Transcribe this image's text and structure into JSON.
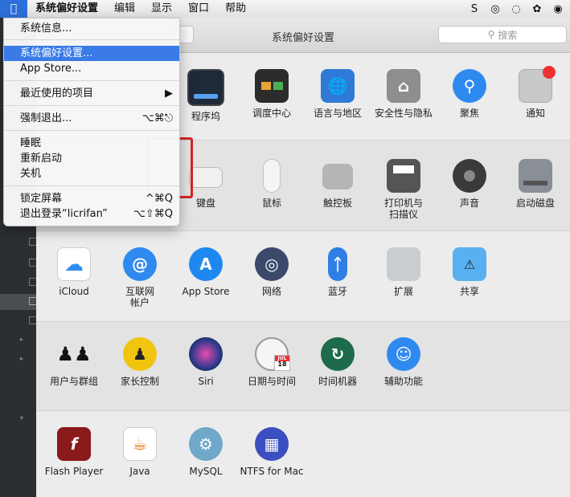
{
  "menubar": {
    "apple": "",
    "items": [
      "系统偏好设置",
      "编辑",
      "显示",
      "窗口",
      "帮助"
    ],
    "tray": [
      "S",
      "◎",
      "◌",
      "✿",
      "◉"
    ]
  },
  "window": {
    "title": "系统偏好设置",
    "search_placeholder": "搜索"
  },
  "apple_menu": {
    "items": [
      {
        "label": "系统信息...",
        "shortcut": ""
      },
      {
        "label": "系统偏好设置...",
        "shortcut": ""
      },
      {
        "label": "App Store...",
        "shortcut": ""
      },
      {
        "label": "最近使用的项目",
        "shortcut": "▶"
      },
      {
        "label": "强制退出...",
        "shortcut": "⌥⌘⎋"
      },
      {
        "label": "睡眠",
        "shortcut": ""
      },
      {
        "label": "重新启动",
        "shortcut": ""
      },
      {
        "label": "关机",
        "shortcut": ""
      },
      {
        "label": "锁定屏幕",
        "shortcut": "^⌘Q"
      },
      {
        "label": "退出登录“licrifan”",
        "shortcut": "⌥⇧⌘Q"
      }
    ]
  },
  "panes": {
    "dock": "程序坞",
    "mission_control": "调度中心",
    "language_region": "语言与地区",
    "security_privacy": "安全性与隐私",
    "spotlight": "聚焦",
    "notifications": "通知",
    "keyboard": "键盘",
    "mouse": "鼠标",
    "trackpad": "触控板",
    "printers": "打印机与\n扫描仪",
    "sound": "声音",
    "startup_disk": "启动磁盘",
    "icloud": "iCloud",
    "internet_accounts": "互联网\n帐户",
    "app_store": "App Store",
    "network": "网络",
    "bluetooth": "蓝牙",
    "extensions": "扩展",
    "sharing": "共享",
    "users_groups": "用户与群组",
    "parental_controls": "家长控制",
    "siri": "Siri",
    "date_time": "日期与时间",
    "time_machine": "时间机器",
    "accessibility": "辅助功能",
    "flash_player": "Flash Player",
    "java": "Java",
    "mysql": "MySQL",
    "ntfs": "NTFS for Mac"
  },
  "calendar_badge": {
    "month": "JUL",
    "day": "18"
  },
  "colors": {
    "accent": "#3a7be8",
    "highlight": "#d42525"
  }
}
